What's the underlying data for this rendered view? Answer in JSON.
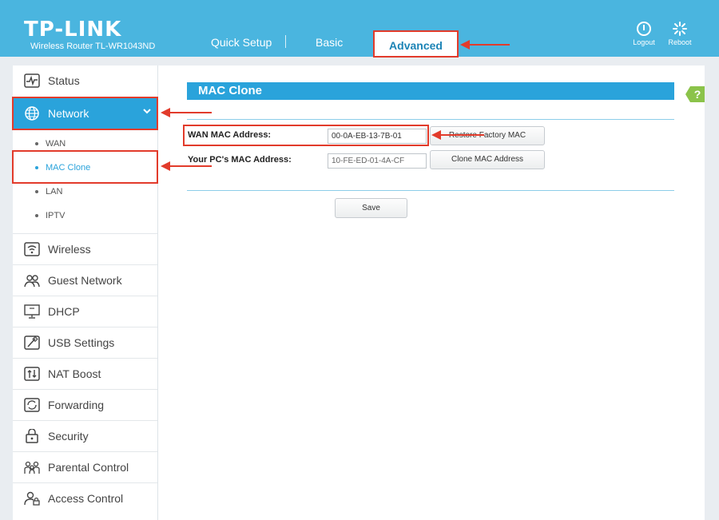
{
  "header": {
    "logo": "TP-LINK",
    "model": "Wireless Router TL-WR1043ND",
    "nav": {
      "quick_setup": "Quick Setup",
      "basic": "Basic",
      "advanced": "Advanced"
    },
    "logout": "Logout",
    "reboot": "Reboot"
  },
  "sidebar": {
    "status": "Status",
    "network": "Network",
    "network_sub": {
      "wan": "WAN",
      "mac_clone": "MAC Clone",
      "lan": "LAN",
      "iptv": "IPTV"
    },
    "wireless": "Wireless",
    "guest_network": "Guest Network",
    "dhcp": "DHCP",
    "usb_settings": "USB Settings",
    "nat_boost": "NAT Boost",
    "forwarding": "Forwarding",
    "security": "Security",
    "parental_control": "Parental Control",
    "access_control": "Access Control"
  },
  "main": {
    "section_title": "MAC Clone",
    "wan_mac_label": "WAN MAC Address:",
    "wan_mac_value": "00-0A-EB-13-7B-01",
    "restore_button": "Restore Factory MAC",
    "pc_mac_label": "Your PC's MAC Address:",
    "pc_mac_value": "10-FE-ED-01-4A-CF",
    "clone_button": "Clone MAC Address",
    "save_button": "Save",
    "help_glyph": "?"
  },
  "colors": {
    "header": "#4ab5df",
    "accent": "#2aa3db",
    "annotation": "#e23b2b"
  }
}
